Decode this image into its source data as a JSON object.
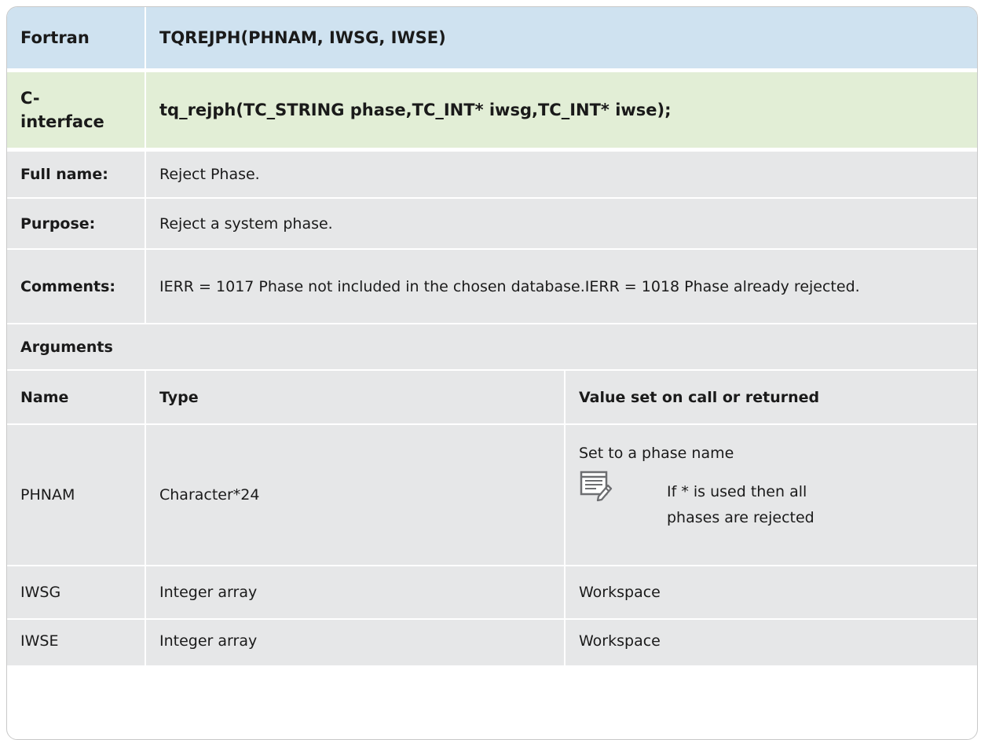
{
  "header": {
    "fortran_label": "Fortran",
    "fortran_signature": "TQREJPH(PHNAM, IWSG, IWSE)",
    "cinterface_label": "C-interface",
    "cinterface_signature": "tq_rejph(TC_STRING phase,TC_INT* iwsg,TC_INT* iwse);"
  },
  "info": {
    "full_name_label": "Full name:",
    "full_name_value": "Reject Phase.",
    "purpose_label": "Purpose:",
    "purpose_value": "Reject a system phase.",
    "comments_label": "Comments:",
    "comments_value": "IERR = 1017 Phase not included in the chosen database.IERR = 1018 Phase already rejected."
  },
  "arguments": {
    "section_label": "Arguments",
    "columns": [
      "Name",
      "Type",
      "Value set on call or returned"
    ],
    "rows": [
      {
        "name": "PHNAM",
        "type": "Character*24",
        "value": "Set to a phase name",
        "note_icon": "note-icon",
        "note": "If * is used then all phases are rejected"
      },
      {
        "name": "IWSG",
        "type": "Integer array",
        "value": "Workspace"
      },
      {
        "name": "IWSE",
        "type": "Integer array",
        "value": "Workspace"
      }
    ]
  }
}
